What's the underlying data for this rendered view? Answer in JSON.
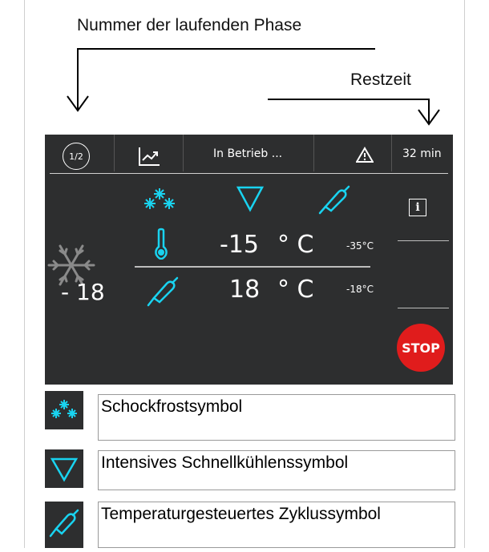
{
  "annotations": {
    "phase_label": "Nummer der laufenden Phase",
    "remaining_label": "Restzeit"
  },
  "header": {
    "phase": "1/2",
    "status": "In Betrieb ...",
    "remaining_time": "32 min"
  },
  "main": {
    "chamber_temp": "-15",
    "chamber_unit": "° C",
    "chamber_target": "-35°C",
    "probe_temp": "18",
    "probe_unit": "° C",
    "probe_target": "-18°C",
    "big_value": "- 18",
    "stop_label": "STOP"
  },
  "legend": [
    {
      "icon": "snowflake-cluster-icon",
      "label": "Schockfrostsymbol"
    },
    {
      "icon": "triangle-down-icon",
      "label": "Intensives Schnellkühlenssymbol"
    },
    {
      "icon": "probe-icon",
      "label": "Temperaturgesteuertes Zyklussymbol"
    }
  ],
  "colors": {
    "panel_bg": "#2d2e2f",
    "accent_cyan": "#19d3f0",
    "stop_red": "#e01c1c"
  }
}
